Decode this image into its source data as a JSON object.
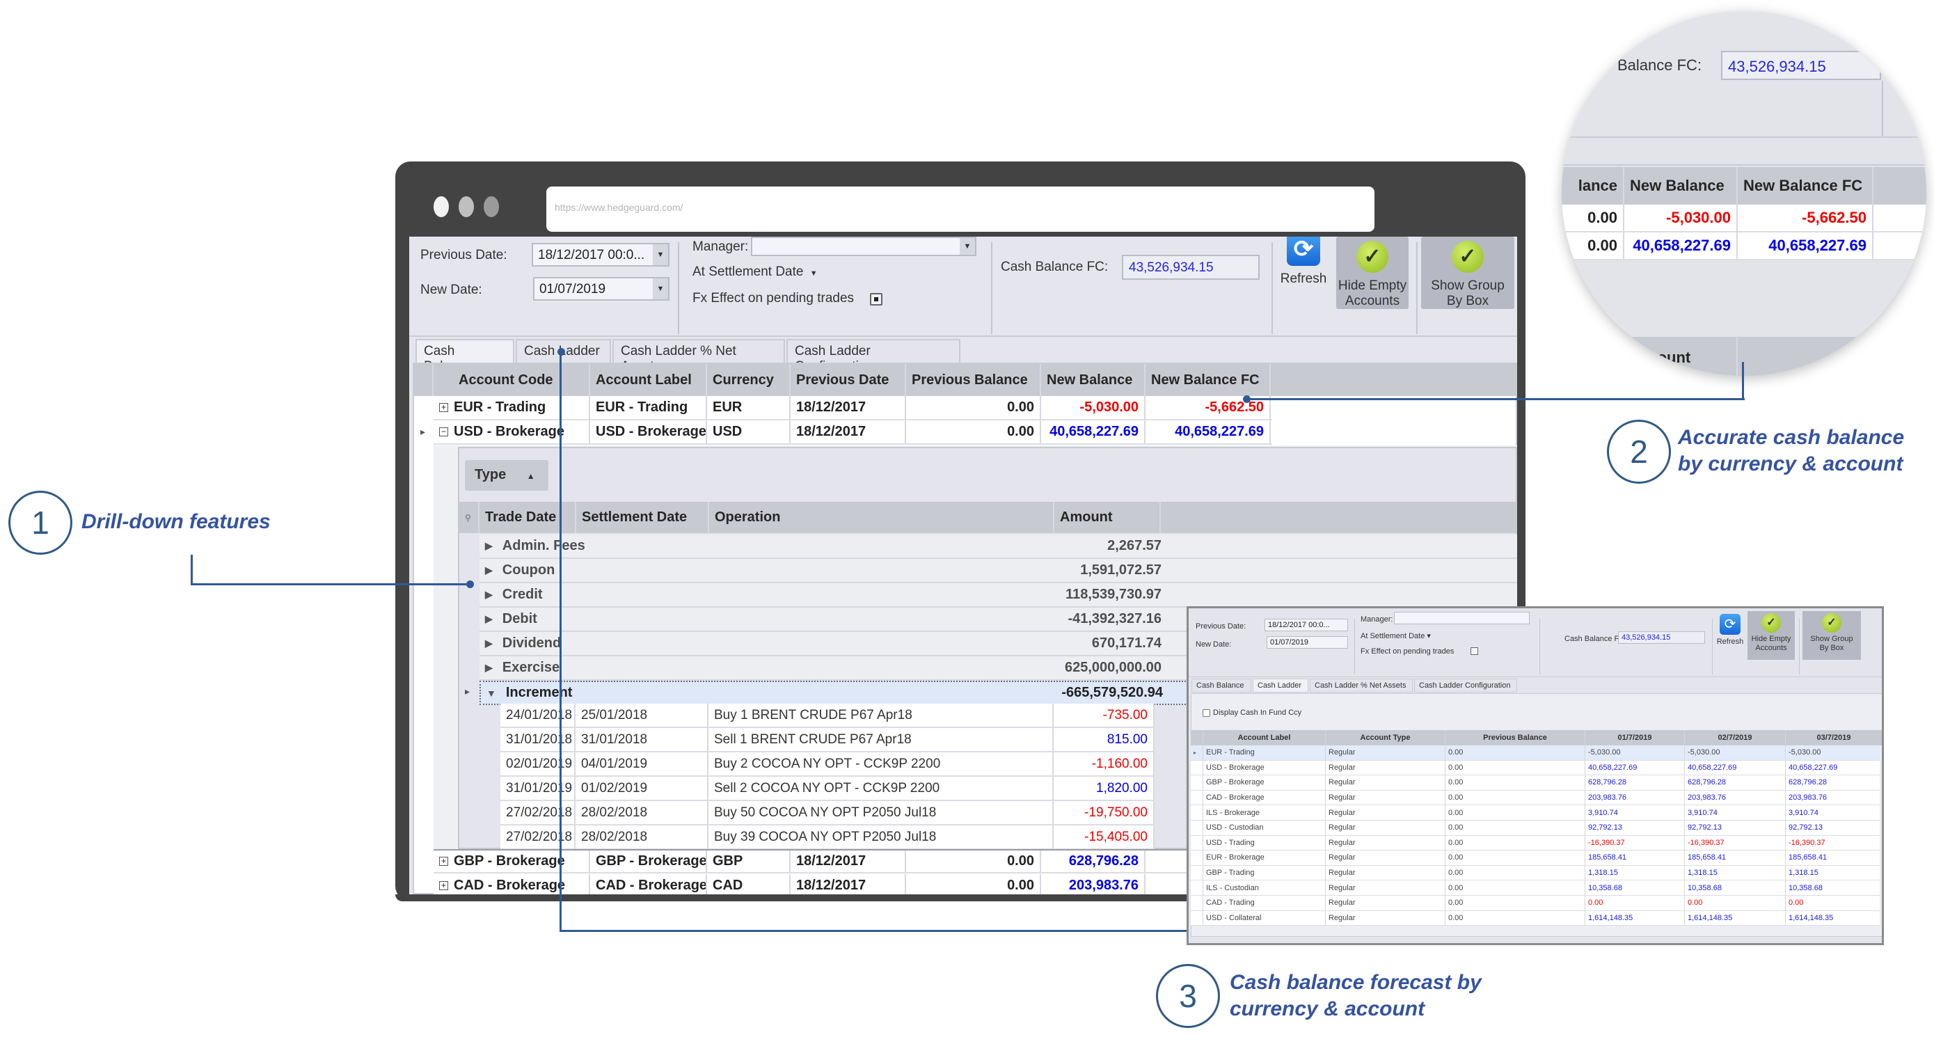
{
  "browser": {
    "url": "https://www.hedgeguard.com/",
    "dots": [
      "#f2f2f2",
      "#bfbfbf",
      "#9a9a9a"
    ]
  },
  "toolbar": {
    "previous_date_label": "Previous Date:",
    "previous_date_value": "18/12/2017 00:0...",
    "new_date_label": "New Date:",
    "new_date_value": "01/07/2019",
    "manager_label": "Manager:",
    "manager_value": "",
    "settlement_mode": "At Settlement Date",
    "fx_effect_label": "Fx Effect on pending trades",
    "cash_balance_fc_label": "Cash Balance FC:",
    "cash_balance_fc_value": "43,526,934.15",
    "refresh_label": "Refresh",
    "hide_empty_label_1": "Hide Empty",
    "hide_empty_label_2": "Accounts",
    "show_group_label_1": "Show Group",
    "show_group_label_2": "By Box"
  },
  "tabs": [
    {
      "label": "Cash Balance",
      "active": true
    },
    {
      "label": "Cash Ladder",
      "active": false
    },
    {
      "label": "Cash Ladder % Net Assets",
      "active": false
    },
    {
      "label": "Cash Ladder Configuration",
      "active": false
    }
  ],
  "grid": {
    "columns": [
      "Account Code",
      "Account Label",
      "Currency",
      "Previous Date",
      "Previous Balance",
      "New Balance",
      "New Balance FC"
    ],
    "rows": [
      {
        "code": "EUR - Trading",
        "label": "EUR - Trading",
        "currency": "EUR",
        "prev_date": "18/12/2017",
        "prev_balance": "0.00",
        "new_balance": "-5,030.00",
        "new_balance_fc": "-5,662.50",
        "expanded": false
      },
      {
        "code": "USD - Brokerage",
        "label": "USD - Brokerage",
        "currency": "USD",
        "prev_date": "18/12/2017",
        "prev_balance": "0.00",
        "new_balance": "40,658,227.69",
        "new_balance_fc": "40,658,227.69",
        "expanded": true
      },
      {
        "code": "GBP - Brokerage",
        "label": "GBP - Brokerage",
        "currency": "GBP",
        "prev_date": "18/12/2017",
        "prev_balance": "0.00",
        "new_balance": "628,796.28",
        "new_balance_fc": "",
        "expanded": false
      },
      {
        "code": "CAD - Brokerage",
        "label": "CAD - Brokerage",
        "currency": "CAD",
        "prev_date": "18/12/2017",
        "prev_balance": "0.00",
        "new_balance": "203,983.76",
        "new_balance_fc": "",
        "expanded": false
      }
    ]
  },
  "detail": {
    "group_by": "Type",
    "columns": [
      "Trade Date",
      "Settlement Date",
      "Operation",
      "Amount"
    ],
    "groups": [
      {
        "name": "Admin. Fees",
        "amount": "2,267.57"
      },
      {
        "name": "Coupon",
        "amount": "1,591,072.57"
      },
      {
        "name": "Credit",
        "amount": "118,539,730.97"
      },
      {
        "name": "Debit",
        "amount": "-41,392,327.16"
      },
      {
        "name": "Dividend",
        "amount": "670,171.74"
      },
      {
        "name": "Exercise",
        "amount": "625,000,000.00"
      },
      {
        "name": "Increment",
        "amount": "-665,579,520.94",
        "expanded": true
      }
    ],
    "increment_rows": [
      {
        "trade_date": "24/01/2018",
        "settlement_date": "25/01/2018",
        "operation": "Buy 1 BRENT CRUDE P67 Apr18",
        "amount": "-735.00"
      },
      {
        "trade_date": "31/01/2018",
        "settlement_date": "31/01/2018",
        "operation": "Sell 1 BRENT CRUDE P67 Apr18",
        "amount": "815.00"
      },
      {
        "trade_date": "02/01/2019",
        "settlement_date": "04/01/2019",
        "operation": "Buy 2 COCOA NY OPT - CCK9P 2200",
        "amount": "-1,160.00"
      },
      {
        "trade_date": "31/01/2019",
        "settlement_date": "01/02/2019",
        "operation": "Sell 2 COCOA NY OPT - CCK9P 2200",
        "amount": "1,820.00"
      },
      {
        "trade_date": "27/02/2018",
        "settlement_date": "28/02/2018",
        "operation": "Buy 50 COCOA NY OPT P2050 Jul18",
        "amount": "-19,750.00"
      },
      {
        "trade_date": "27/02/2018",
        "settlement_date": "28/02/2018",
        "operation": "Buy 39 COCOA NY OPT P2050 Jul18",
        "amount": "-15,405.00"
      }
    ]
  },
  "magnifier": {
    "cash_label_partial": "Balance FC:",
    "cash_value": "43,526,934.15",
    "col_partial": "lance",
    "col_new_balance": "New Balance",
    "col_new_balance_fc": "New Balance FC",
    "rows": [
      {
        "prev": "0.00",
        "new": "-5,030.00",
        "fc": "-5,662.50"
      },
      {
        "prev": "0.00",
        "new": "40,658,227.69",
        "fc": "40,658,227.69"
      }
    ],
    "amount_partial": "mount"
  },
  "ladder": {
    "display_fund_ccy_label": "Display Cash In Fund Ccy",
    "active_tab": "Cash Ladder",
    "columns": [
      "Account Label",
      "Account Type",
      "Previous Balance",
      "01/7/2019",
      "02/7/2019",
      "03/7/2019"
    ],
    "rows": [
      {
        "label": "EUR - Trading",
        "type": "Regular",
        "prev": "0.00",
        "d1": "-5,030.00",
        "d2": "-5,030.00",
        "d3": "-5,030.00",
        "neg": false
      },
      {
        "label": "USD - Brokerage",
        "type": "Regular",
        "prev": "0.00",
        "d1": "40,658,227.69",
        "d2": "40,658,227.69",
        "d3": "40,658,227.69",
        "neg": false
      },
      {
        "label": "GBP - Brokerage",
        "type": "Regular",
        "prev": "0.00",
        "d1": "628,796.28",
        "d2": "628,796.28",
        "d3": "628,796.28",
        "neg": false
      },
      {
        "label": "CAD - Brokerage",
        "type": "Regular",
        "prev": "0.00",
        "d1": "203,983.76",
        "d2": "203,983.76",
        "d3": "203,983.76",
        "neg": false
      },
      {
        "label": "ILS - Brokerage",
        "type": "Regular",
        "prev": "0.00",
        "d1": "3,910.74",
        "d2": "3,910.74",
        "d3": "3,910.74",
        "neg": false
      },
      {
        "label": "USD - Custodian",
        "type": "Regular",
        "prev": "0.00",
        "d1": "92,792.13",
        "d2": "92,792.13",
        "d3": "92,792.13",
        "neg": false
      },
      {
        "label": "USD - Trading",
        "type": "Regular",
        "prev": "0.00",
        "d1": "-16,390.37",
        "d2": "-16,390.37",
        "d3": "-16,390.37",
        "neg": true
      },
      {
        "label": "EUR - Brokerage",
        "type": "Regular",
        "prev": "0.00",
        "d1": "185,658.41",
        "d2": "185,658.41",
        "d3": "185,658.41",
        "neg": false
      },
      {
        "label": "GBP - Trading",
        "type": "Regular",
        "prev": "0.00",
        "d1": "1,318.15",
        "d2": "1,318.15",
        "d3": "1,318.15",
        "neg": false
      },
      {
        "label": "ILS - Custodian",
        "type": "Regular",
        "prev": "0.00",
        "d1": "10,358.68",
        "d2": "10,358.68",
        "d3": "10,358.68",
        "neg": false
      },
      {
        "label": "CAD - Trading",
        "type": "Regular",
        "prev": "0.00",
        "d1": "0.00",
        "d2": "0.00",
        "d3": "0.00",
        "neg": true
      },
      {
        "label": "USD - Collateral",
        "type": "Regular",
        "prev": "0.00",
        "d1": "1,614,148.35",
        "d2": "1,614,148.35",
        "d3": "1,614,148.35",
        "neg": false
      }
    ]
  },
  "callouts": [
    {
      "number": "1",
      "text": "Drill-down features"
    },
    {
      "number": "2",
      "text_line1": "Accurate cash balance",
      "text_line2": "by currency & account"
    },
    {
      "number": "3",
      "text_line1": "Cash balance forecast by",
      "text_line2": "currency & account"
    }
  ],
  "colors": {
    "negative": "#f20000",
    "positive": "#0000ee",
    "accent": "#2f5a96",
    "frame": "#434343"
  }
}
